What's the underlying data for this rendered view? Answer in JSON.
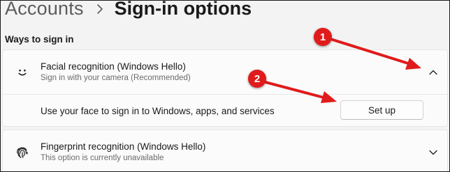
{
  "header": {
    "parent": "Accounts",
    "separator_icon": "chevron-right-icon",
    "current": "Sign-in options"
  },
  "section_label": "Ways to sign in",
  "facial": {
    "icon": "smiley-face-icon",
    "title": "Facial recognition (Windows Hello)",
    "description": "Sign in with your camera (Recommended)",
    "expanded": true,
    "chevron_icon": "chevron-up-icon",
    "sub_text": "Use your face to sign in to Windows, apps, and services",
    "setup_label": "Set up"
  },
  "fingerprint": {
    "icon": "fingerprint-icon",
    "title": "Fingerprint recognition (Windows Hello)",
    "description": "This option is currently unavailable",
    "expanded": false,
    "chevron_icon": "chevron-down-icon"
  },
  "annotations": {
    "badge_1": "1",
    "badge_2": "2",
    "arrow_color": "#e01b1b"
  }
}
